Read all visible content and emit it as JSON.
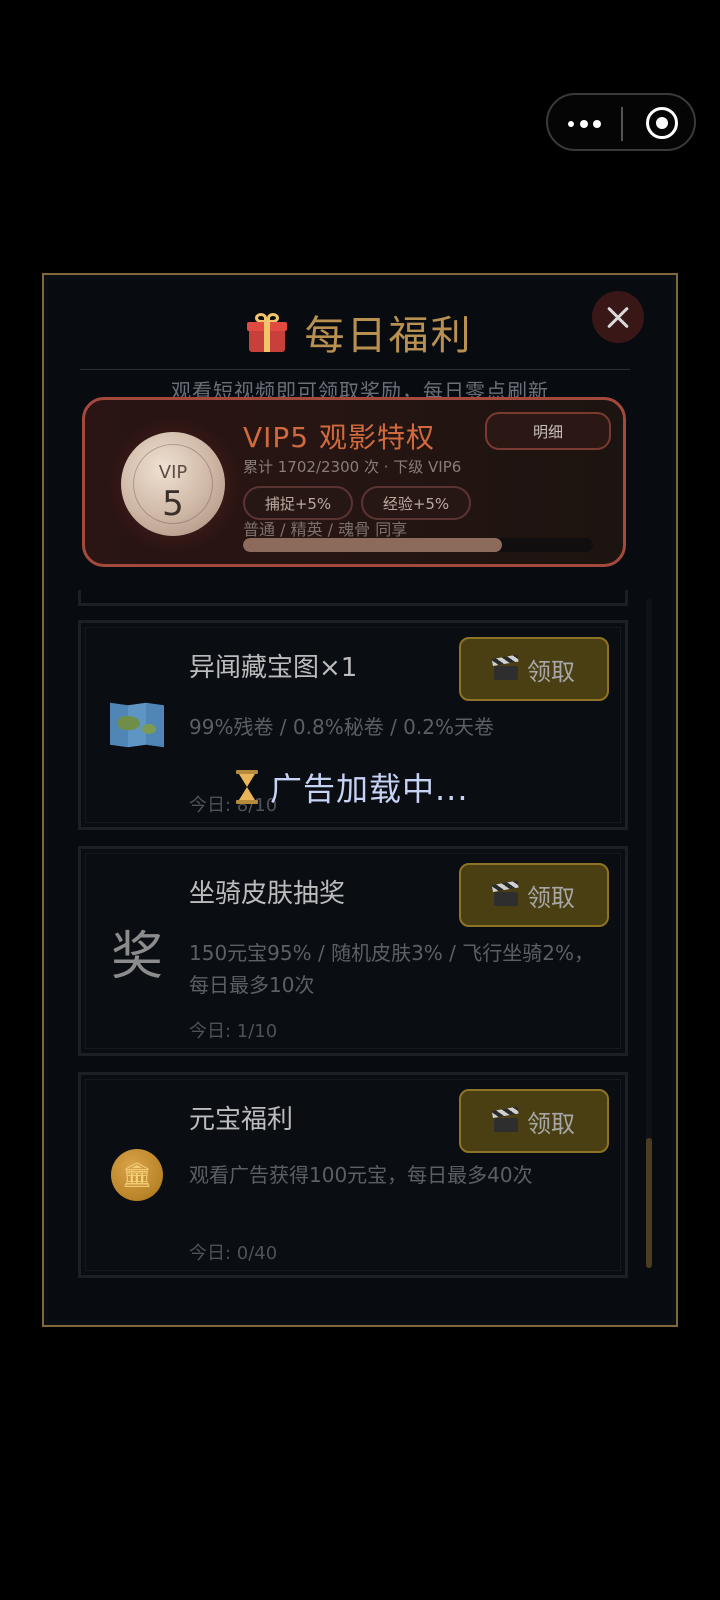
{
  "header": {
    "title": "每日福利",
    "subtitle": "观看短视频即可领取奖励，每日零点刷新"
  },
  "vip": {
    "badge_label": "VIP",
    "level": "5",
    "name": "VIP5 观影特权",
    "progress_text": "累计 1702/2300 次 · 下级 VIP6",
    "detail_label": "明细",
    "tags": [
      "捕捉+5%",
      "经验+5%"
    ],
    "share_text": "普通 / 精英 / 魂骨 同享",
    "progress_fraction": 0.74
  },
  "rewards": [
    {
      "icon": "treasure-map-icon",
      "name": "异闻藏宝图×1",
      "desc": "99%残卷 / 0.8%秘卷 / 0.2%天卷",
      "count": "今日: 8/10",
      "claim_label": "领取"
    },
    {
      "icon": "prize-character-icon",
      "icon_text": "奖",
      "name": "坐骑皮肤抽奖",
      "desc": "150元宝95% / 随机皮肤3% / 飞行坐骑2%，每日最多10次",
      "count": "今日: 1/10",
      "claim_label": "领取"
    },
    {
      "icon": "gold-coin-icon",
      "icon_text": "🏛",
      "name": "元宝福利",
      "desc": "观看广告获得100元宝，每日最多40次",
      "count": "今日: 0/40",
      "claim_label": "领取"
    }
  ],
  "loading_text": "广告加载中...",
  "colors": {
    "gold_border": "#7d6a3c",
    "title_gold": "#b89050",
    "vip_accent": "#d06a3e",
    "claim_bg": "#4a3f12",
    "loading_text": "#c7d3f4"
  }
}
